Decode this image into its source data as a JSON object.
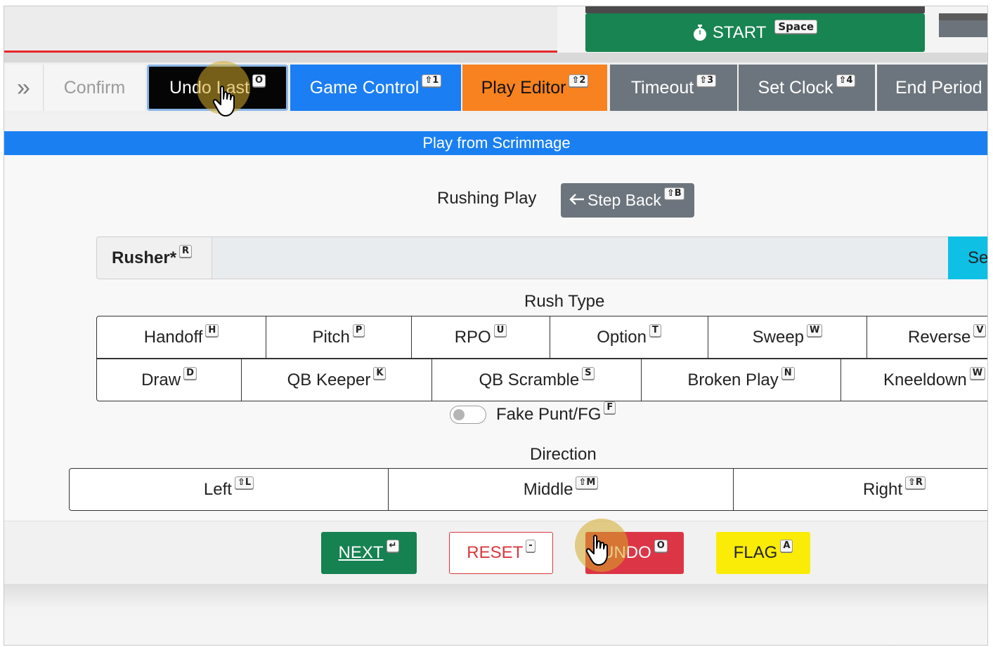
{
  "timer": {
    "start_label": "START",
    "start_key": "Space"
  },
  "toolbar": {
    "overflow_icon": "»",
    "items": [
      {
        "label": "Confirm",
        "key": ""
      },
      {
        "label": "Undo Last",
        "key": "O"
      },
      {
        "label": "Game Control",
        "key": "⇧1"
      },
      {
        "label": "Play Editor",
        "key": "⇧2"
      },
      {
        "label": "Timeout",
        "key": "⇧3"
      },
      {
        "label": "Set Clock",
        "key": "⇧4"
      },
      {
        "label": "End Period",
        "key": ""
      }
    ]
  },
  "panel": {
    "title": "Play from Scrimmage",
    "play_type": "Rushing Play",
    "step_back_label": "Step Back",
    "step_back_key": "⇧B"
  },
  "rusher": {
    "label": "Rusher*",
    "key": "R",
    "select_label": "Se"
  },
  "rush_type": {
    "label": "Rush Type",
    "row1": [
      {
        "label": "Handoff",
        "key": "H"
      },
      {
        "label": "Pitch",
        "key": "P"
      },
      {
        "label": "RPO",
        "key": "U"
      },
      {
        "label": "Option",
        "key": "T"
      },
      {
        "label": "Sweep",
        "key": "W"
      },
      {
        "label": "Reverse",
        "key": "V"
      }
    ],
    "row2": [
      {
        "label": "Draw",
        "key": "D"
      },
      {
        "label": "QB Keeper",
        "key": "K"
      },
      {
        "label": "QB Scramble",
        "key": "S"
      },
      {
        "label": "Broken Play",
        "key": "N"
      },
      {
        "label": "Kneeldown",
        "key": "W"
      }
    ]
  },
  "fake": {
    "label": "Fake Punt/FG",
    "key": "F",
    "checked": false
  },
  "direction": {
    "label": "Direction",
    "options": [
      {
        "label": "Left",
        "key": "⇧L"
      },
      {
        "label": "Middle",
        "key": "⇧M"
      },
      {
        "label": "Right",
        "key": "⇧R"
      }
    ]
  },
  "footer": {
    "next_label": "NEXT",
    "next_key": "↵",
    "reset_label": "RESET",
    "reset_key": "-",
    "undo_label": "UNDO",
    "undo_key": "O",
    "flag_label": "FLAG",
    "flag_key": "A"
  },
  "colors": {
    "start_green": "#178451",
    "game_control_blue": "#1b7ef3",
    "play_editor_orange": "#f8821f",
    "secondary_gray": "#6c757d",
    "title_blue": "#1a80f2",
    "undo_red": "#dc3545",
    "flag_yellow": "#fbec07",
    "select_cyan": "#0fc0e5"
  }
}
